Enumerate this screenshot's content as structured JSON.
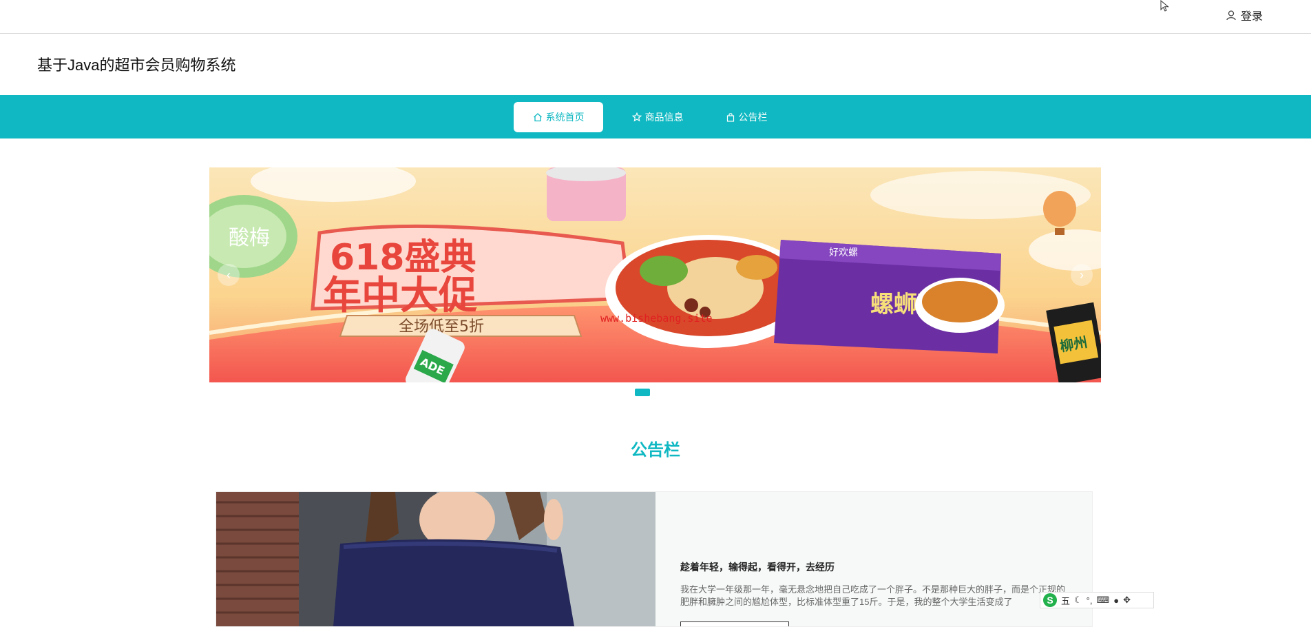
{
  "topbar": {
    "login_label": "登录"
  },
  "header": {
    "title": "基于Java的超市会员购物系统"
  },
  "nav": {
    "items": [
      {
        "label": "系统首页",
        "icon": "home-icon",
        "active": true
      },
      {
        "label": "商品信息",
        "icon": "star-icon",
        "active": false
      },
      {
        "label": "公告栏",
        "icon": "bag-icon",
        "active": false
      }
    ]
  },
  "banner": {
    "headline_line1": "618盛典",
    "headline_line2": "年中大促",
    "subtitle": "全场低至5折",
    "watermark": "www.bishebang.site",
    "product_brand": "好欢螺",
    "product_name": "螺蛳粉",
    "left_jar_text": "酸梅",
    "drink_text": "ADE",
    "snack_text": "柳州"
  },
  "notice_section": {
    "title": "公告栏",
    "items": [
      {
        "title": "趁着年轻，输得起，看得开，去经历",
        "text": "我在大学一年级那一年，毫无悬念地把自己吃成了一个胖子。不是那种巨大的胖子，而是个正规的肥胖和臃肿之间的尴尬体型，比标准体型重了15斤。于是，我的整个大学生活变成了"
      }
    ]
  },
  "ime": {
    "mode": "五"
  },
  "colors": {
    "accent": "#0fb8c2",
    "watermark": "#e02020"
  }
}
